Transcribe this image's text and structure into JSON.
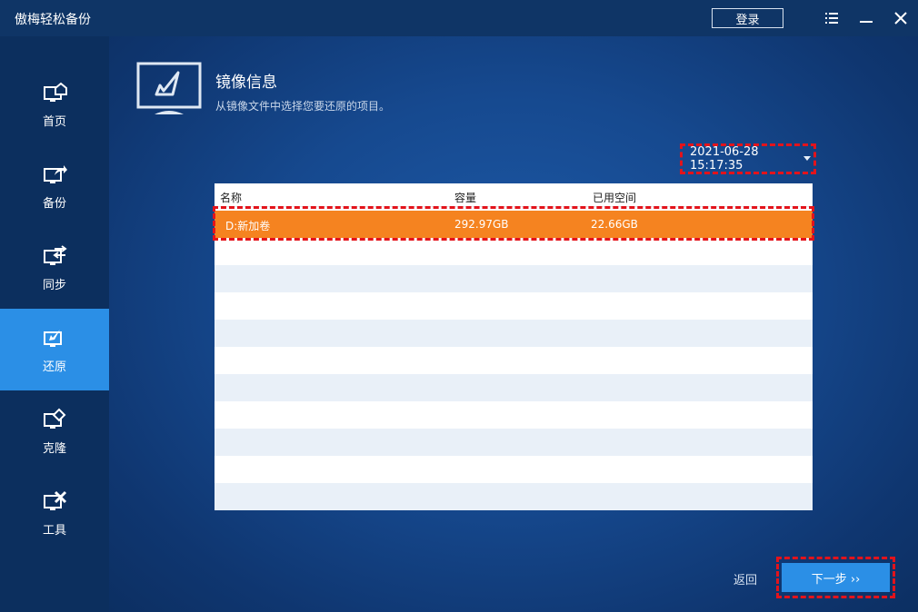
{
  "app": {
    "title": "傲梅轻松备份"
  },
  "titlebar": {
    "login_label": "登录"
  },
  "sidebar": {
    "items": [
      {
        "label": "首页",
        "icon": "home-icon"
      },
      {
        "label": "备份",
        "icon": "backup-icon"
      },
      {
        "label": "同步",
        "icon": "sync-icon"
      },
      {
        "label": "还原",
        "icon": "restore-icon",
        "active": true
      },
      {
        "label": "克隆",
        "icon": "clone-icon"
      },
      {
        "label": "工具",
        "icon": "tools-icon"
      }
    ]
  },
  "main": {
    "title": "镜像信息",
    "subtitle": "从镜像文件中选择您要还原的项目。",
    "date_value": "2021-06-28 15:17:35",
    "table": {
      "columns": [
        "名称",
        "容量",
        "已用空间"
      ],
      "rows": [
        {
          "name": "D:新加卷",
          "capacity": "292.97GB",
          "used": "22.66GB",
          "selected": true
        }
      ]
    },
    "back_label": "返回",
    "next_label": "下一步 ››"
  },
  "colors": {
    "accent": "#2b8fe6",
    "selected_row": "#f58320",
    "highlight_border": "#e3131b"
  }
}
